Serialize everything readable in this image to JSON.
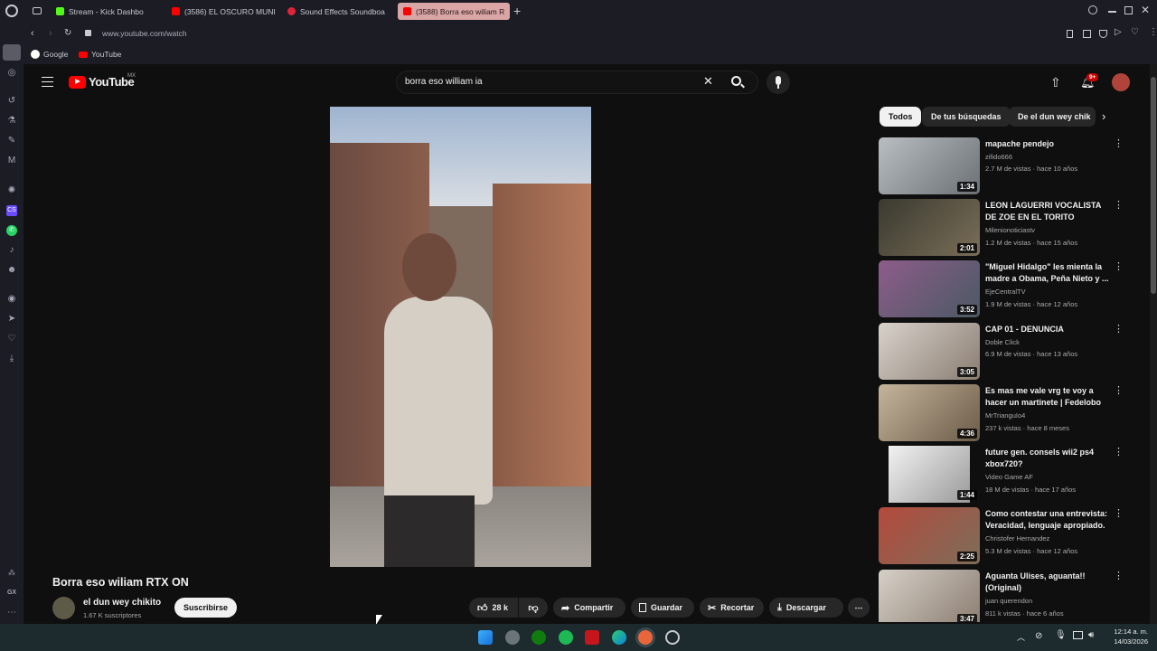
{
  "browser": {
    "tabs": [
      {
        "label": "Stream - Kick Dashbo",
        "favicon_color": "#53fc18",
        "active": false
      },
      {
        "label": "(3586) EL OSCURO MUNI",
        "favicon_color": "#ff0000",
        "active": false
      },
      {
        "label": "Sound Effects Soundboa",
        "favicon_color": "#e0223a",
        "active": false
      },
      {
        "label": "(3588) Borra eso wiliam R",
        "favicon_color": "#ff0000",
        "active": true
      }
    ],
    "url": "www.youtube.com/watch",
    "bookmarks": [
      {
        "label": "Google"
      },
      {
        "label": "YouTube"
      }
    ],
    "sidebar_bottom_label": "GX"
  },
  "youtube": {
    "logo_text": "YouTube",
    "region": "MX",
    "search_value": "borra eso william ia",
    "notifications_badge": "9+",
    "video": {
      "title": "Borra eso wiliam RTX ON",
      "channel": "el dun wey chikito",
      "subscribers": "1.67 K suscriptores",
      "subscribe_label": "Suscribirse",
      "likes": "28 k",
      "share_label": "Compartir",
      "save_label": "Guardar",
      "clip_label": "Recortar",
      "download_label": "Descargar"
    },
    "chips": [
      "Todos",
      "De tus búsquedas",
      "De el dun wey chik"
    ],
    "recommendations": [
      {
        "title": "mapache pendejo",
        "channel": "zifido666",
        "meta": "2.7 M de vistas · hace 10 años",
        "duration": "1:34",
        "thumb_color": "#8a8f94"
      },
      {
        "title": "LEON LAGUERRI VOCALISTA DE ZOE EN EL TORITO",
        "channel": "Milenionoticiastv",
        "meta": "1.2 M de vistas · hace 15 años",
        "duration": "2:01",
        "thumb_color": "#4b4a3f"
      },
      {
        "title": "\"Miguel Hidalgo\" les mienta la madre a Obama, Peña Nieto y ...",
        "channel": "EjeCentralTV",
        "meta": "1.9 M de vistas · hace 12 años",
        "duration": "3:52",
        "thumb_color": "#6d5a6e"
      },
      {
        "title": "CAP 01 - DENUNCIA",
        "channel": "Doble Click",
        "meta": "6.9 M de vistas · hace 13 años",
        "duration": "3:05",
        "thumb_color": "#9c8f86"
      },
      {
        "title": "Es mas me vale vrg te voy a hacer un martinete | Fedelobo ...",
        "channel": "MrTrianguIo4",
        "meta": "237 k vistas · hace 8 meses",
        "duration": "4:36",
        "thumb_color": "#8f7b62"
      },
      {
        "title": "future gen. consels wii2 ps4 xbox720?",
        "channel": "Video Game AF",
        "meta": "18 M de vistas · hace 17 años",
        "duration": "1:44",
        "thumb_color": "#cfcfcf"
      },
      {
        "title": "Como contestar una entrevista: Veracidad, lenguaje apropiado.",
        "channel": "Christofer Hernandez",
        "meta": "5.3 M de vistas · hace 12 años",
        "duration": "2:25",
        "thumb_color": "#7c6b58"
      },
      {
        "title": "Aguanta Ulises, aguanta!! (Original)",
        "channel": "juan querendon",
        "meta": "811 k vistas · hace 6 años",
        "duration": "3:47",
        "thumb_color": "#a29a90"
      }
    ]
  },
  "taskbar": {
    "time": "12:14 a. m.",
    "date": "14/03/2026"
  },
  "colors": {
    "youtube_red": "#ff0000",
    "background": "#0f0f0f",
    "chrome": "#1c1c24",
    "taskbar": "#1d2b2f",
    "active_tab": "#d9a5a5"
  }
}
